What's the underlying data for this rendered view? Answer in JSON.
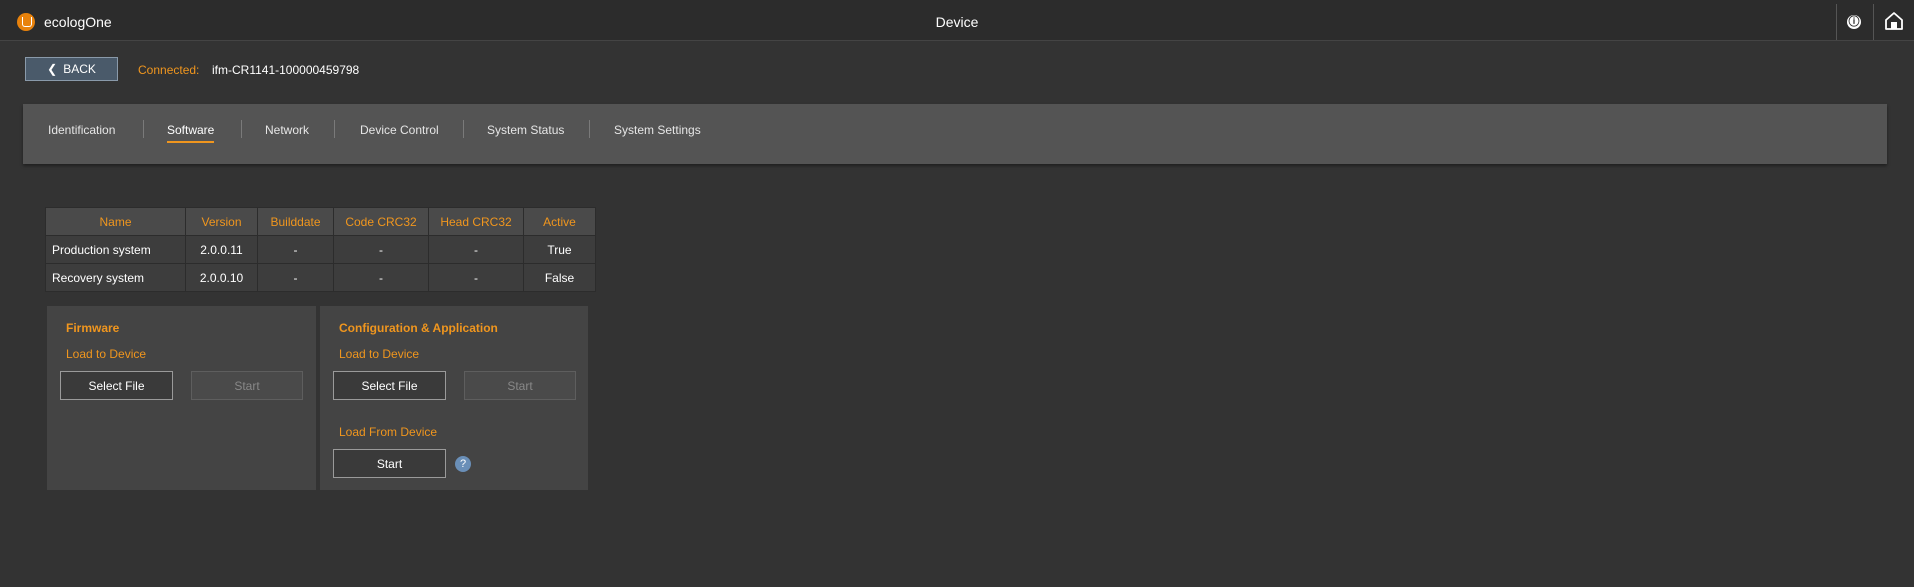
{
  "header": {
    "app_name": "ecologOne",
    "title": "Device",
    "info_icon": "ⓘ",
    "icons": [
      "logo-icon",
      "info-icon",
      "home-icon"
    ]
  },
  "connection": {
    "back_label": "BACK",
    "connected_label": "Connected:",
    "device_name": "ifm-CR1141-100000459798"
  },
  "tabs": [
    {
      "label": "Identification",
      "active": false
    },
    {
      "label": "Software",
      "active": true
    },
    {
      "label": "Network",
      "active": false
    },
    {
      "label": "Device Control",
      "active": false
    },
    {
      "label": "System Status",
      "active": false
    },
    {
      "label": "System Settings",
      "active": false
    }
  ],
  "software_table": {
    "columns": [
      "Name",
      "Version",
      "Builddate",
      "Code CRC32",
      "Head CRC32",
      "Active"
    ],
    "rows": [
      [
        "Production system",
        "2.0.0.11",
        "-",
        "-",
        "-",
        "True"
      ],
      [
        "Recovery system",
        "2.0.0.10",
        "-",
        "-",
        "-",
        "False"
      ]
    ]
  },
  "firmware": {
    "title": "Firmware",
    "load_to_device": "Load to Device",
    "select_file": "Select File",
    "start": "Start"
  },
  "config": {
    "title": "Configuration & Application",
    "load_to_device": "Load to Device",
    "select_file": "Select File",
    "start": "Start",
    "load_from_device": "Load From Device",
    "from_start": "Start",
    "help_glyph": "?"
  },
  "colors": {
    "accent": "#f0961e",
    "background": "#333333",
    "topbar": "#2c2c2c",
    "tabbar": "#545454",
    "panel": "#444444",
    "help": "#6a8fb8"
  }
}
